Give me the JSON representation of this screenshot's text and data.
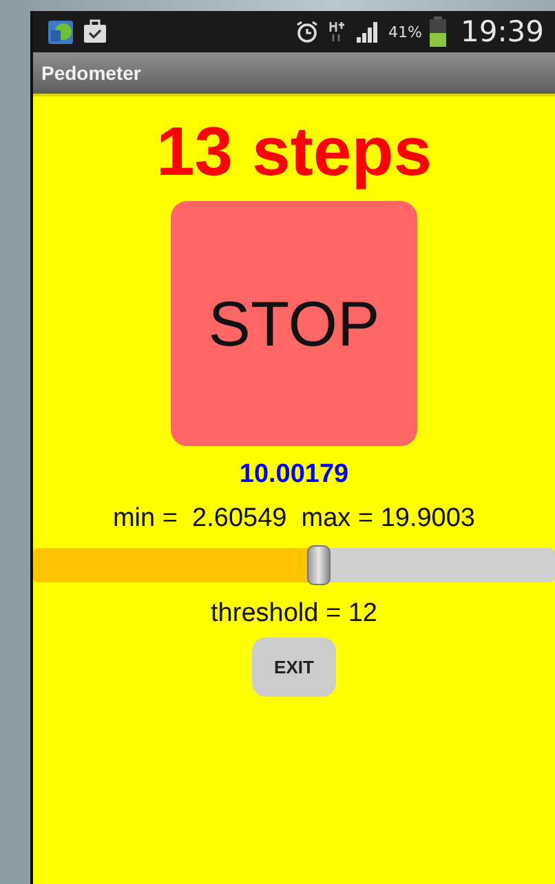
{
  "status_bar": {
    "battery_text": "41%",
    "time": "19:39"
  },
  "window": {
    "title": "Pedometer"
  },
  "steps": "13 steps",
  "stop_button": {
    "label": "STOP"
  },
  "reading": "10.00179",
  "range": "min =  2.60549  max = 19.9003",
  "slider": {
    "level": 0.55
  },
  "threshold": "threshold = 12",
  "exit_button": {
    "label": "EXIT"
  }
}
